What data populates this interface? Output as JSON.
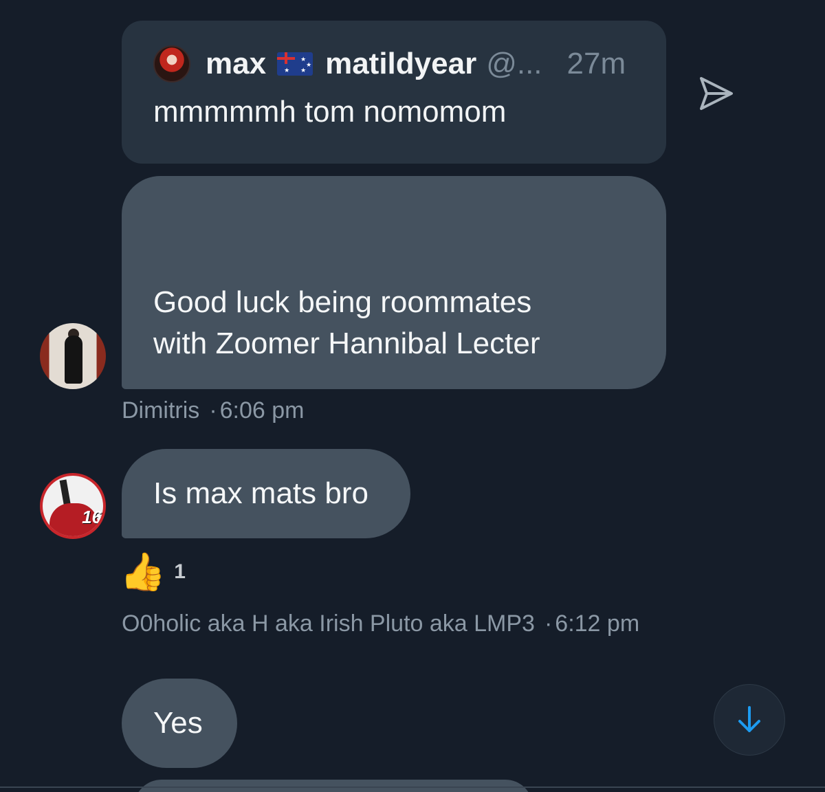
{
  "quoted_tweet": {
    "display_name": "max",
    "flag_emoji": "🇦🇺",
    "display_name_suffix": "matildyear",
    "handle_truncated": "@...",
    "time_ago": "27m",
    "text": "mmmmmh tom nomomom"
  },
  "messages": [
    {
      "text_line1": "Good luck being roommates",
      "text_line2": "with Zoomer Hannibal Lecter",
      "sender": "Dimitris",
      "time": "6:06 pm"
    },
    {
      "text": "Is max mats bro",
      "reaction_emoji": "👍",
      "reaction_count": "1",
      "sender": "O0holic aka H aka Irish Pluto aka LMP3",
      "time": "6:12 pm",
      "avatar_number": "16"
    },
    {
      "text": "Yes"
    }
  ],
  "meta_separator": "·",
  "colors": {
    "background": "#151d29",
    "bubble": "#45525f",
    "quote_card": "#273340",
    "accent": "#1d9bf0",
    "muted_text": "#8b98a5"
  },
  "icons": {
    "share": "share-icon",
    "scroll_down": "arrow-down-icon"
  }
}
